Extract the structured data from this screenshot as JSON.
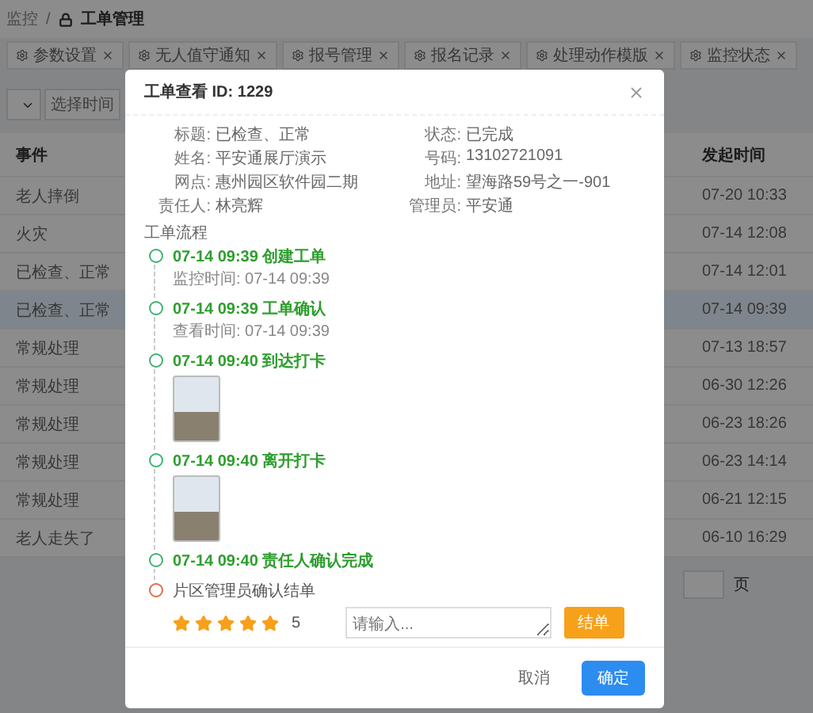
{
  "breadcrumb": {
    "parent": "监控",
    "separator": "/",
    "current": "工单管理"
  },
  "tabs": [
    {
      "label": "参数设置",
      "selected": false
    },
    {
      "label": "无人值守通知",
      "selected": false
    },
    {
      "label": "报号管理",
      "selected": false
    },
    {
      "label": "报名记录",
      "selected": false
    },
    {
      "label": "处理动作模版",
      "selected": false
    },
    {
      "label": "监控状态",
      "selected": false
    }
  ],
  "filters": {
    "time_placeholder": "选择时间"
  },
  "table": {
    "columns": [
      "事件",
      "发起时间"
    ],
    "rows": [
      {
        "event": "老人摔倒",
        "time": "07-20 10:33",
        "selected": false
      },
      {
        "event": "火灾",
        "time": "07-14 12:08",
        "selected": false
      },
      {
        "event": "已检查、正常",
        "time": "07-14 12:01",
        "selected": false
      },
      {
        "event": "已检查、正常",
        "time": "07-14 09:39",
        "selected": true
      },
      {
        "event": "常规处理",
        "time": "07-13 18:57",
        "selected": false
      },
      {
        "event": "常规处理",
        "time": "06-30 12:26",
        "selected": false
      },
      {
        "event": "常规处理",
        "time": "06-23 18:26",
        "selected": false
      },
      {
        "event": "常规处理",
        "time": "06-23 14:14",
        "selected": false
      },
      {
        "event": "常规处理",
        "time": "06-21 12:15",
        "selected": false
      },
      {
        "event": "老人走失了",
        "time": "06-10 16:29",
        "selected": false
      }
    ]
  },
  "pagination": {
    "unit": "页"
  },
  "modal": {
    "title": "工单查看 ID: 1229",
    "details": [
      {
        "label": "标题:",
        "value": "已检查、正常"
      },
      {
        "label": "状态:",
        "value": "已完成"
      },
      {
        "label": "姓名:",
        "value": "平安通展厅演示"
      },
      {
        "label": "号码:",
        "value": "13102721091"
      },
      {
        "label": "网点:",
        "value": "惠州园区软件园二期"
      },
      {
        "label": "地址:",
        "value": "望海路59号之一-901"
      },
      {
        "label": "责任人:",
        "value": "林亮辉"
      },
      {
        "label": "管理员:",
        "value": "平安通"
      }
    ],
    "flow_label": "工单流程",
    "flow": [
      {
        "title": "07-14 09:39 创建工单",
        "done": true,
        "sub": "监控时间: 07-14 09:39",
        "photo": false
      },
      {
        "title": "07-14 09:39 工单确认",
        "done": true,
        "sub": "查看时间: 07-14 09:39",
        "photo": false
      },
      {
        "title": "07-14 09:40 到达打卡",
        "done": true,
        "photo": true
      },
      {
        "title": "07-14 09:40 离开打卡",
        "done": true,
        "photo": true
      },
      {
        "title": "07-14 09:40 责任人确认完成",
        "done": true,
        "photo": false
      },
      {
        "title": "片区管理员确认结单",
        "done": false,
        "photo": false,
        "rating": {
          "stars": 5,
          "reading": "5",
          "placeholder": "请输入...",
          "button": "结单"
        }
      }
    ],
    "buttons": {
      "cancel": "取消",
      "ok": "确定"
    }
  }
}
